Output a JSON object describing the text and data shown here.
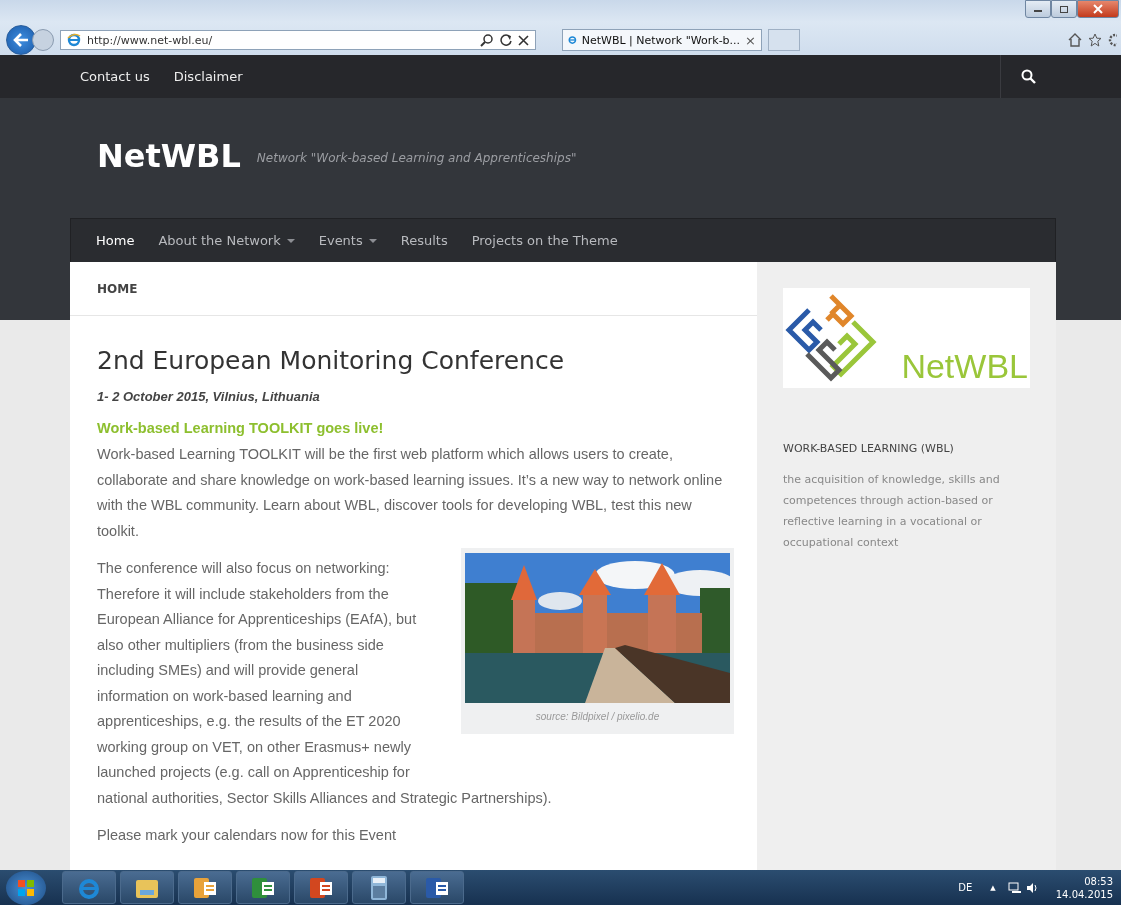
{
  "browser": {
    "address": "http://www.net-wbl.eu/",
    "tab_title": "NetWBL | Network \"Work-b...",
    "tab_close": "×"
  },
  "topbar": {
    "links": [
      "Contact us",
      "Disclaimer"
    ]
  },
  "site": {
    "title": "NetWBL",
    "tagline": "Network \"Work-based Learning and Apprenticeships\""
  },
  "nav": [
    {
      "label": "Home",
      "dropdown": false,
      "selected": true
    },
    {
      "label": "About the Network",
      "dropdown": true,
      "selected": false
    },
    {
      "label": "Events",
      "dropdown": true,
      "selected": false
    },
    {
      "label": "Results",
      "dropdown": false,
      "selected": false
    },
    {
      "label": "Projects on the Theme",
      "dropdown": false,
      "selected": false
    }
  ],
  "breadcrumb": "HOME",
  "article": {
    "heading": "2nd European Monitoring Conference",
    "date": "1- 2 October 2015, Vilnius, Lithuania",
    "subheading": "Work-based Learning TOOLKIT goes live!",
    "intro": "Work-based Learning TOOLKIT will be the first web platform which allows users to create, collaborate and share knowledge on work-based learning issues. It’s a new way to network online with the WBL community. Learn about WBL, discover tools for developing WBL, test this new toolkit.",
    "body": "The conference will also focus on networking: Therefore it will include stakeholders from the European Alliance for Apprenticeships (EAfA), but also other multipliers (from the business side including SMEs) and will provide general information on work-based learning and apprenticeships, e.g. the results of the ET 2020 working group on VET, on other Erasmus+ newly launched projects (e.g. call on Apprenticeship for",
    "body_end": "national authorities, Sector Skills Alliances and Strategic Partnerships).",
    "last": "Please mark your calendars now for this Event",
    "figure": {
      "kind": "picture",
      "caption": "source: Bildpixel / pixelio.de"
    }
  },
  "sidebar": {
    "logo_text": "NetWBL",
    "widget_title": "WORK-BASED LEARNING (WBL)",
    "widget_text": "the acquisition of knowledge, skills and competences through action-based or reflective learning in a vocational or occupational context"
  },
  "taskbar": {
    "apps": [
      {
        "kind": "ie"
      },
      {
        "kind": "explorer"
      },
      {
        "kind": "outlook"
      },
      {
        "kind": "excel"
      },
      {
        "kind": "powerpoint"
      },
      {
        "kind": "calculator"
      },
      {
        "kind": "word"
      }
    ],
    "language": "DE",
    "tray_arrow": "▲",
    "time": "08:53",
    "date": "14.04.2015"
  }
}
